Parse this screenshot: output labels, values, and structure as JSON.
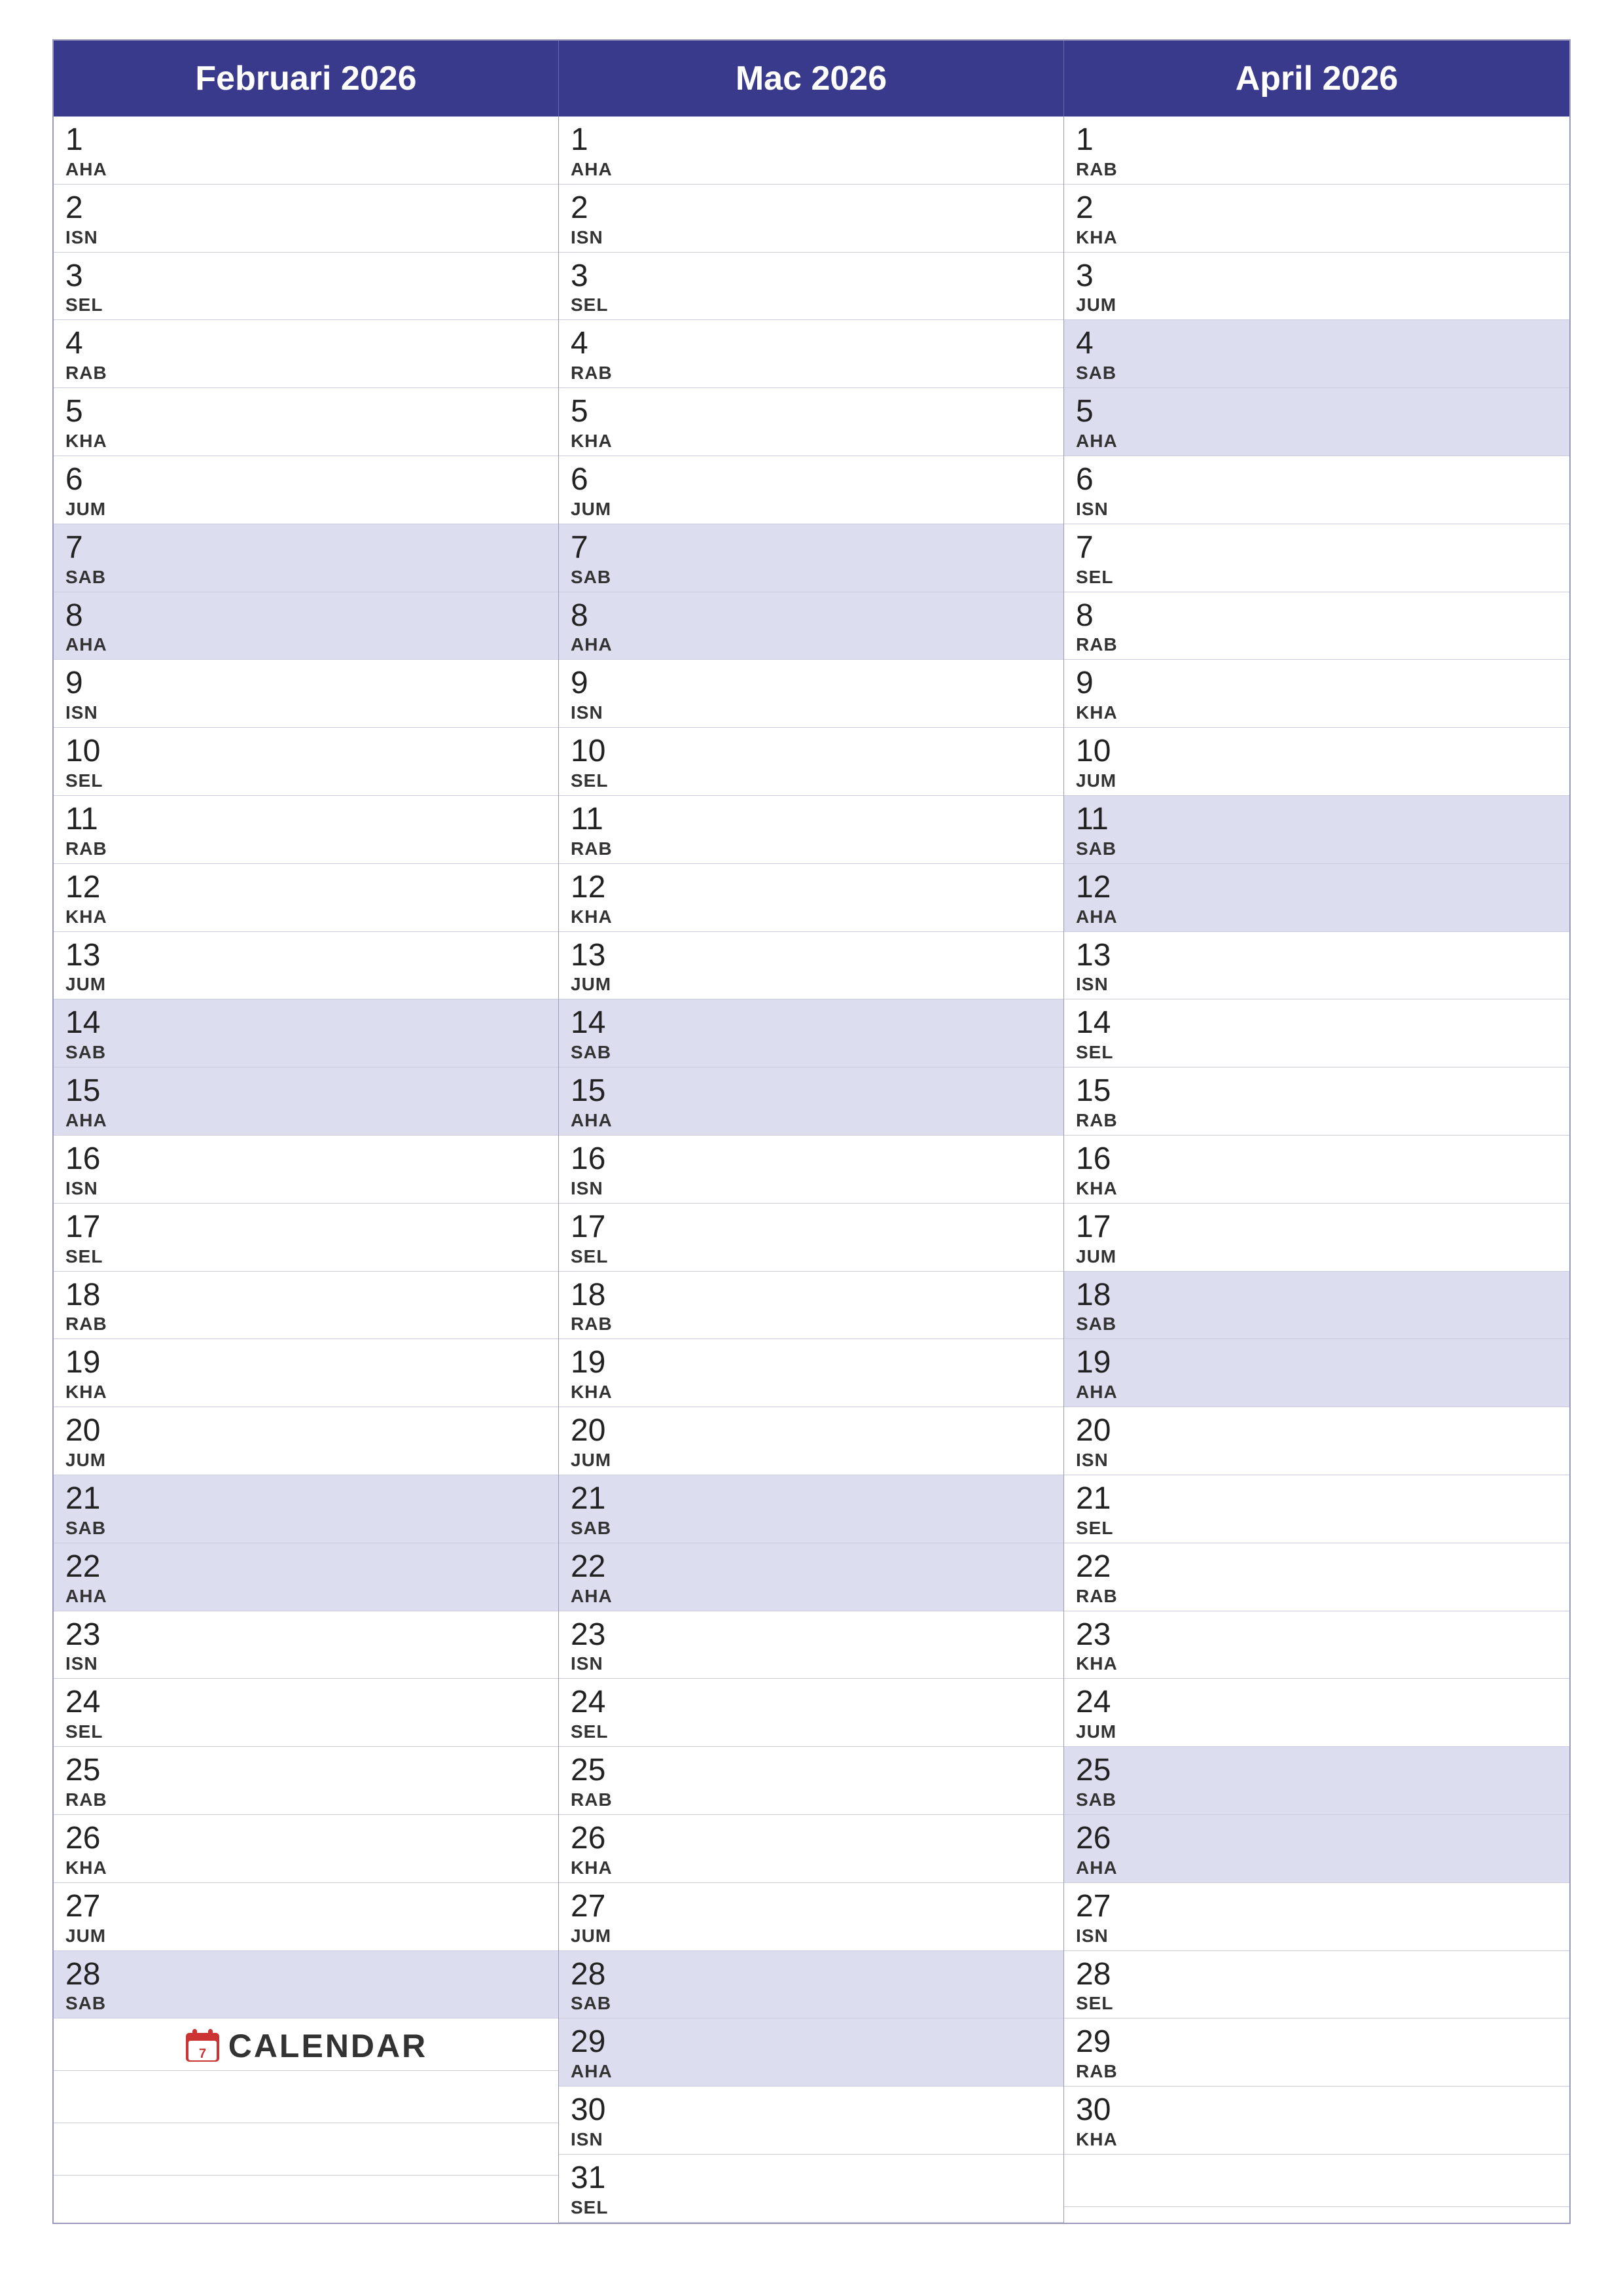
{
  "months": [
    {
      "name": "Februari 2026",
      "days": [
        {
          "num": "1",
          "day": "AHA",
          "highlight": false
        },
        {
          "num": "2",
          "day": "ISN",
          "highlight": false
        },
        {
          "num": "3",
          "day": "SEL",
          "highlight": false
        },
        {
          "num": "4",
          "day": "RAB",
          "highlight": false
        },
        {
          "num": "5",
          "day": "KHA",
          "highlight": false
        },
        {
          "num": "6",
          "day": "JUM",
          "highlight": false
        },
        {
          "num": "7",
          "day": "SAB",
          "highlight": true
        },
        {
          "num": "8",
          "day": "AHA",
          "highlight": true
        },
        {
          "num": "9",
          "day": "ISN",
          "highlight": false
        },
        {
          "num": "10",
          "day": "SEL",
          "highlight": false
        },
        {
          "num": "11",
          "day": "RAB",
          "highlight": false
        },
        {
          "num": "12",
          "day": "KHA",
          "highlight": false
        },
        {
          "num": "13",
          "day": "JUM",
          "highlight": false
        },
        {
          "num": "14",
          "day": "SAB",
          "highlight": true
        },
        {
          "num": "15",
          "day": "AHA",
          "highlight": true
        },
        {
          "num": "16",
          "day": "ISN",
          "highlight": false
        },
        {
          "num": "17",
          "day": "SEL",
          "highlight": false
        },
        {
          "num": "18",
          "day": "RAB",
          "highlight": false
        },
        {
          "num": "19",
          "day": "KHA",
          "highlight": false
        },
        {
          "num": "20",
          "day": "JUM",
          "highlight": false
        },
        {
          "num": "21",
          "day": "SAB",
          "highlight": true
        },
        {
          "num": "22",
          "day": "AHA",
          "highlight": true
        },
        {
          "num": "23",
          "day": "ISN",
          "highlight": false
        },
        {
          "num": "24",
          "day": "SEL",
          "highlight": false
        },
        {
          "num": "25",
          "day": "RAB",
          "highlight": false
        },
        {
          "num": "26",
          "day": "KHA",
          "highlight": false
        },
        {
          "num": "27",
          "day": "JUM",
          "highlight": false
        },
        {
          "num": "28",
          "day": "SAB",
          "highlight": true
        }
      ]
    },
    {
      "name": "Mac 2026",
      "days": [
        {
          "num": "1",
          "day": "AHA",
          "highlight": false
        },
        {
          "num": "2",
          "day": "ISN",
          "highlight": false
        },
        {
          "num": "3",
          "day": "SEL",
          "highlight": false
        },
        {
          "num": "4",
          "day": "RAB",
          "highlight": false
        },
        {
          "num": "5",
          "day": "KHA",
          "highlight": false
        },
        {
          "num": "6",
          "day": "JUM",
          "highlight": false
        },
        {
          "num": "7",
          "day": "SAB",
          "highlight": true
        },
        {
          "num": "8",
          "day": "AHA",
          "highlight": true
        },
        {
          "num": "9",
          "day": "ISN",
          "highlight": false
        },
        {
          "num": "10",
          "day": "SEL",
          "highlight": false
        },
        {
          "num": "11",
          "day": "RAB",
          "highlight": false
        },
        {
          "num": "12",
          "day": "KHA",
          "highlight": false
        },
        {
          "num": "13",
          "day": "JUM",
          "highlight": false
        },
        {
          "num": "14",
          "day": "SAB",
          "highlight": true
        },
        {
          "num": "15",
          "day": "AHA",
          "highlight": true
        },
        {
          "num": "16",
          "day": "ISN",
          "highlight": false
        },
        {
          "num": "17",
          "day": "SEL",
          "highlight": false
        },
        {
          "num": "18",
          "day": "RAB",
          "highlight": false
        },
        {
          "num": "19",
          "day": "KHA",
          "highlight": false
        },
        {
          "num": "20",
          "day": "JUM",
          "highlight": false
        },
        {
          "num": "21",
          "day": "SAB",
          "highlight": true
        },
        {
          "num": "22",
          "day": "AHA",
          "highlight": true
        },
        {
          "num": "23",
          "day": "ISN",
          "highlight": false
        },
        {
          "num": "24",
          "day": "SEL",
          "highlight": false
        },
        {
          "num": "25",
          "day": "RAB",
          "highlight": false
        },
        {
          "num": "26",
          "day": "KHA",
          "highlight": false
        },
        {
          "num": "27",
          "day": "JUM",
          "highlight": false
        },
        {
          "num": "28",
          "day": "SAB",
          "highlight": true
        },
        {
          "num": "29",
          "day": "AHA",
          "highlight": true
        },
        {
          "num": "30",
          "day": "ISN",
          "highlight": false
        },
        {
          "num": "31",
          "day": "SEL",
          "highlight": false
        }
      ]
    },
    {
      "name": "April 2026",
      "days": [
        {
          "num": "1",
          "day": "RAB",
          "highlight": false
        },
        {
          "num": "2",
          "day": "KHA",
          "highlight": false
        },
        {
          "num": "3",
          "day": "JUM",
          "highlight": false
        },
        {
          "num": "4",
          "day": "SAB",
          "highlight": true
        },
        {
          "num": "5",
          "day": "AHA",
          "highlight": true
        },
        {
          "num": "6",
          "day": "ISN",
          "highlight": false
        },
        {
          "num": "7",
          "day": "SEL",
          "highlight": false
        },
        {
          "num": "8",
          "day": "RAB",
          "highlight": false
        },
        {
          "num": "9",
          "day": "KHA",
          "highlight": false
        },
        {
          "num": "10",
          "day": "JUM",
          "highlight": false
        },
        {
          "num": "11",
          "day": "SAB",
          "highlight": true
        },
        {
          "num": "12",
          "day": "AHA",
          "highlight": true
        },
        {
          "num": "13",
          "day": "ISN",
          "highlight": false
        },
        {
          "num": "14",
          "day": "SEL",
          "highlight": false
        },
        {
          "num": "15",
          "day": "RAB",
          "highlight": false
        },
        {
          "num": "16",
          "day": "KHA",
          "highlight": false
        },
        {
          "num": "17",
          "day": "JUM",
          "highlight": false
        },
        {
          "num": "18",
          "day": "SAB",
          "highlight": true
        },
        {
          "num": "19",
          "day": "AHA",
          "highlight": true
        },
        {
          "num": "20",
          "day": "ISN",
          "highlight": false
        },
        {
          "num": "21",
          "day": "SEL",
          "highlight": false
        },
        {
          "num": "22",
          "day": "RAB",
          "highlight": false
        },
        {
          "num": "23",
          "day": "KHA",
          "highlight": false
        },
        {
          "num": "24",
          "day": "JUM",
          "highlight": false
        },
        {
          "num": "25",
          "day": "SAB",
          "highlight": true
        },
        {
          "num": "26",
          "day": "AHA",
          "highlight": true
        },
        {
          "num": "27",
          "day": "ISN",
          "highlight": false
        },
        {
          "num": "28",
          "day": "SEL",
          "highlight": false
        },
        {
          "num": "29",
          "day": "RAB",
          "highlight": false
        },
        {
          "num": "30",
          "day": "KHA",
          "highlight": false
        }
      ]
    }
  ],
  "logo": {
    "text": "CALENDAR",
    "icon_color": "#cc3333"
  }
}
